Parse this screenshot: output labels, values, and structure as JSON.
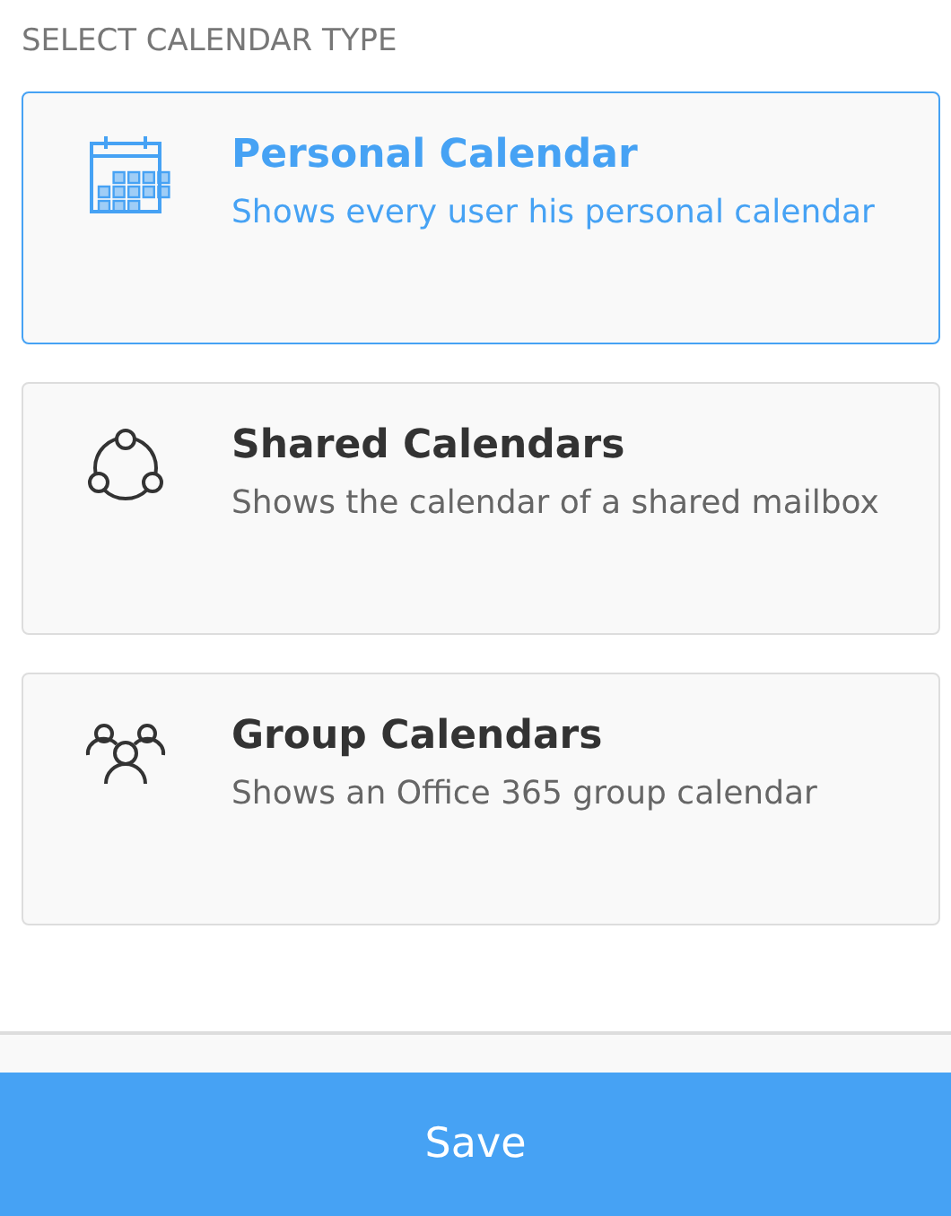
{
  "heading": "SELECT CALENDAR TYPE",
  "options": [
    {
      "kind": "personal",
      "title": "Personal Calendar",
      "description": "Shows every user his personal calendar",
      "selected": true
    },
    {
      "kind": "shared",
      "title": "Shared Calendars",
      "description": "Shows the calendar of a shared mailbox",
      "selected": false
    },
    {
      "kind": "group",
      "title": "Group Calendars",
      "description": "Shows an Office 365 group calendar",
      "selected": false
    }
  ],
  "save_button": "Save"
}
